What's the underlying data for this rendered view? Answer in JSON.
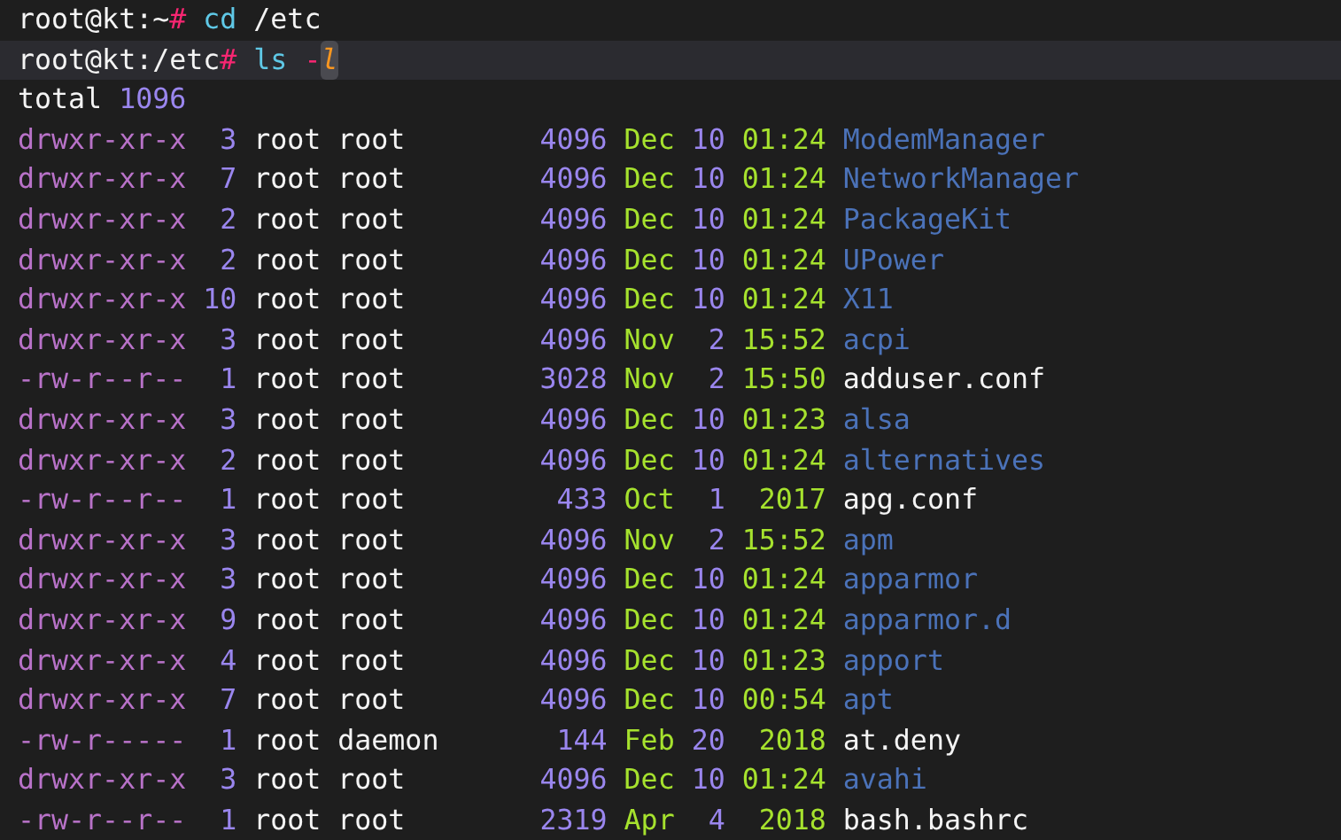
{
  "commands": [
    {
      "prompt": "root@kt:~",
      "symbol": "#",
      "command": "cd",
      "args": "/etc",
      "current": false
    },
    {
      "prompt": "root@kt:/etc",
      "symbol": "#",
      "command": "ls",
      "args": "-",
      "cursor_text": "l",
      "current": true
    }
  ],
  "total": {
    "label": "total",
    "value": "1096"
  },
  "entries": [
    {
      "perms": "drwxr-xr-x",
      "links": "3",
      "owner": "root",
      "group": "root",
      "size": "4096",
      "month": "Dec",
      "day": "10",
      "time": "01:24",
      "name": "ModemManager",
      "kind": "dir"
    },
    {
      "perms": "drwxr-xr-x",
      "links": "7",
      "owner": "root",
      "group": "root",
      "size": "4096",
      "month": "Dec",
      "day": "10",
      "time": "01:24",
      "name": "NetworkManager",
      "kind": "dir"
    },
    {
      "perms": "drwxr-xr-x",
      "links": "2",
      "owner": "root",
      "group": "root",
      "size": "4096",
      "month": "Dec",
      "day": "10",
      "time": "01:24",
      "name": "PackageKit",
      "kind": "dir"
    },
    {
      "perms": "drwxr-xr-x",
      "links": "2",
      "owner": "root",
      "group": "root",
      "size": "4096",
      "month": "Dec",
      "day": "10",
      "time": "01:24",
      "name": "UPower",
      "kind": "dir"
    },
    {
      "perms": "drwxr-xr-x",
      "links": "10",
      "owner": "root",
      "group": "root",
      "size": "4096",
      "month": "Dec",
      "day": "10",
      "time": "01:24",
      "name": "X11",
      "kind": "dir"
    },
    {
      "perms": "drwxr-xr-x",
      "links": "3",
      "owner": "root",
      "group": "root",
      "size": "4096",
      "month": "Nov",
      "day": "2",
      "time": "15:52",
      "name": "acpi",
      "kind": "dir"
    },
    {
      "perms": "-rw-r--r--",
      "links": "1",
      "owner": "root",
      "group": "root",
      "size": "3028",
      "month": "Nov",
      "day": "2",
      "time": "15:50",
      "name": "adduser.conf",
      "kind": "file"
    },
    {
      "perms": "drwxr-xr-x",
      "links": "3",
      "owner": "root",
      "group": "root",
      "size": "4096",
      "month": "Dec",
      "day": "10",
      "time": "01:23",
      "name": "alsa",
      "kind": "dir"
    },
    {
      "perms": "drwxr-xr-x",
      "links": "2",
      "owner": "root",
      "group": "root",
      "size": "4096",
      "month": "Dec",
      "day": "10",
      "time": "01:24",
      "name": "alternatives",
      "kind": "dir"
    },
    {
      "perms": "-rw-r--r--",
      "links": "1",
      "owner": "root",
      "group": "root",
      "size": "433",
      "month": "Oct",
      "day": "1",
      "time": "2017",
      "name": "apg.conf",
      "kind": "file"
    },
    {
      "perms": "drwxr-xr-x",
      "links": "3",
      "owner": "root",
      "group": "root",
      "size": "4096",
      "month": "Nov",
      "day": "2",
      "time": "15:52",
      "name": "apm",
      "kind": "dir"
    },
    {
      "perms": "drwxr-xr-x",
      "links": "3",
      "owner": "root",
      "group": "root",
      "size": "4096",
      "month": "Dec",
      "day": "10",
      "time": "01:24",
      "name": "apparmor",
      "kind": "dir"
    },
    {
      "perms": "drwxr-xr-x",
      "links": "9",
      "owner": "root",
      "group": "root",
      "size": "4096",
      "month": "Dec",
      "day": "10",
      "time": "01:24",
      "name": "apparmor.d",
      "kind": "dir"
    },
    {
      "perms": "drwxr-xr-x",
      "links": "4",
      "owner": "root",
      "group": "root",
      "size": "4096",
      "month": "Dec",
      "day": "10",
      "time": "01:23",
      "name": "apport",
      "kind": "dir"
    },
    {
      "perms": "drwxr-xr-x",
      "links": "7",
      "owner": "root",
      "group": "root",
      "size": "4096",
      "month": "Dec",
      "day": "10",
      "time": "00:54",
      "name": "apt",
      "kind": "dir"
    },
    {
      "perms": "-rw-r-----",
      "links": "1",
      "owner": "root",
      "group": "daemon",
      "size": "144",
      "month": "Feb",
      "day": "20",
      "time": "2018",
      "name": "at.deny",
      "kind": "file"
    },
    {
      "perms": "drwxr-xr-x",
      "links": "3",
      "owner": "root",
      "group": "root",
      "size": "4096",
      "month": "Dec",
      "day": "10",
      "time": "01:24",
      "name": "avahi",
      "kind": "dir"
    },
    {
      "perms": "-rw-r--r--",
      "links": "1",
      "owner": "root",
      "group": "root",
      "size": "2319",
      "month": "Apr",
      "day": "4",
      "time": "2018",
      "name": "bash.bashrc",
      "kind": "file"
    }
  ]
}
